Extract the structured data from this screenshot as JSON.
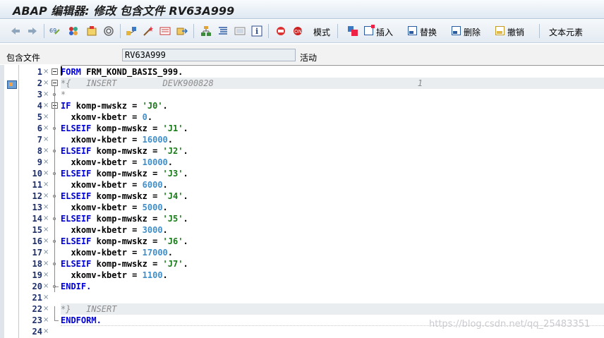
{
  "window": {
    "title": "ABAP 编辑器: 修改 包含文件 RV63A999"
  },
  "toolbar": {
    "icons": [
      "back-icon",
      "forward-icon",
      "other-object-icon",
      "display-change-icon",
      "activate-icon",
      "check-icon",
      "where-used-icon",
      "object-list-icon",
      "wand-icon",
      "display-object-icon",
      "navigate-icon",
      "hierarchy-icon",
      "pretty-printer-icon",
      "fullscreen-icon",
      "info-icon",
      "enhancement-icon",
      "switch-enhancement-icon"
    ],
    "mode_label": "模式",
    "insert_label": "插入",
    "replace_label": "替换",
    "delete_label": "删除",
    "undo_label": "撤销",
    "text_elements_label": "文本元素"
  },
  "include": {
    "label": "包含文件",
    "name": "RV63A999",
    "status": "活动"
  },
  "code": {
    "lines": [
      {
        "num": "1",
        "text": "FORM FRM_KOND_BASIS_999."
      },
      {
        "num": "2",
        "text": "*{   INSERT         DEVK900828                                        1"
      },
      {
        "num": "3",
        "text": "*"
      },
      {
        "num": "4",
        "text": "IF komp-mwskz = 'J0'."
      },
      {
        "num": "5",
        "text": "  xkomv-kbetr = 0."
      },
      {
        "num": "6",
        "text": "ELSEIF komp-mwskz = 'J1'."
      },
      {
        "num": "7",
        "text": "  xkomv-kbetr = 16000."
      },
      {
        "num": "8",
        "text": "ELSEIF komp-mwskz = 'J2'."
      },
      {
        "num": "9",
        "text": "  xkomv-kbetr = 10000."
      },
      {
        "num": "10",
        "text": "ELSEIF komp-mwskz = 'J3'."
      },
      {
        "num": "11",
        "text": "  xkomv-kbetr = 6000."
      },
      {
        "num": "12",
        "text": "ELSEIF komp-mwskz = 'J4'."
      },
      {
        "num": "13",
        "text": "  xkomv-kbetr = 5000."
      },
      {
        "num": "14",
        "text": "ELSEIF komp-mwskz = 'J5'."
      },
      {
        "num": "15",
        "text": "  xkomv-kbetr = 3000."
      },
      {
        "num": "16",
        "text": "ELSEIF komp-mwskz = 'J6'."
      },
      {
        "num": "17",
        "text": "  xkomv-kbetr = 17000."
      },
      {
        "num": "18",
        "text": "ELSEIF komp-mwskz = 'J7'."
      },
      {
        "num": "19",
        "text": "  xkomv-kbetr = 1100."
      },
      {
        "num": "20",
        "text": "ENDIF."
      },
      {
        "num": "21",
        "text": ""
      },
      {
        "num": "22",
        "text": "*}   INSERT"
      },
      {
        "num": "23",
        "text": "ENDFORM."
      },
      {
        "num": "24",
        "text": ""
      }
    ]
  },
  "watermark": "https://blog.csdn.net/qq_25483351",
  "colors": {
    "keyword": "#0000d8",
    "string": "#1a7a1a",
    "number": "#3f8fcb",
    "comment": "#8c8c8c",
    "line_number": "#1d2f6b"
  }
}
